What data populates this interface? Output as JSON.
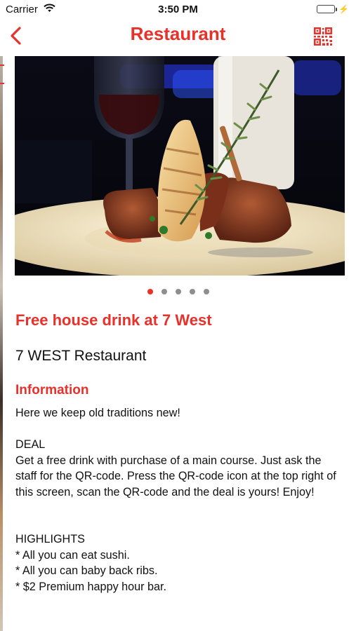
{
  "status_bar": {
    "carrier": "Carrier",
    "time": "3:50 PM",
    "battery_level": 1.0,
    "battery_color": "#4cd964"
  },
  "nav": {
    "title": "Restaurant",
    "back_icon": "chevron-left-icon",
    "right_icon": "qr-code-icon",
    "accent_color": "#e8312a"
  },
  "hero": {
    "image": "plated-steak-dish-photo",
    "pager_count": 5,
    "pager_active": 1
  },
  "deal": {
    "title": "Free house drink at 7 West",
    "venue": "7 WEST Restaurant",
    "info_heading": "Information",
    "info_body": "Here we keep old traditions new!\n\nDEAL\nGet a free drink with purchase of a main course. Just ask the staff for the QR-code. Press the QR-code icon at the top right of this screen, scan the QR-code and the deal is yours! Enjoy!\n\n\nHIGHLIGHTS\n* All you can eat sushi.\n* All you can baby back ribs.\n* $2 Premium happy hour bar."
  }
}
